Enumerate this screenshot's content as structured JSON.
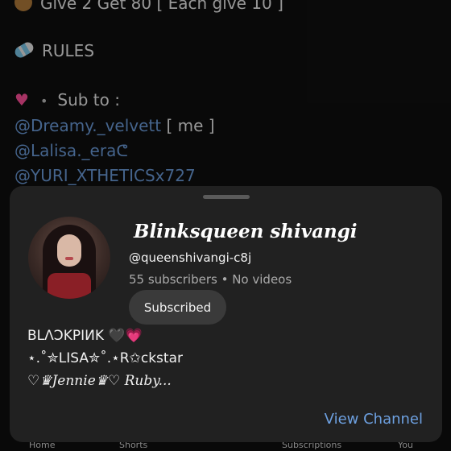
{
  "post": {
    "line1": "Give 2 Get 80 [ Each give 10 ]",
    "line2": "RULES",
    "sub_to_label": "Sub to :",
    "handle1": "@Dreamy._velvett",
    "handle1_suffix": "[ me ]",
    "handle2": "@Lalisa._eraᕦ",
    "handle3": "@YURI_XTHETICSx727",
    "icons": [
      "cookie-icon",
      "candy-icon",
      "heart-icon"
    ]
  },
  "bottom_nav": {
    "items": [
      "Home",
      "Shorts",
      "Subscriptions",
      "You"
    ]
  },
  "channel_sheet": {
    "name": "Blinksqueen shivangi",
    "handle": "@queenshivangi-c8j",
    "meta": "55 subscribers • No videos",
    "subscribe_label": "Subscribed",
    "description": [
      "BLΛϽKPIИK 🖤💗",
      "⋆.˚✮LISA✮˚.⋆R✩ckstar",
      "♡♛Jennie♛♡ Ruby..."
    ],
    "view_channel_label": "View Channel"
  },
  "colors": {
    "background": "#0f0f0f",
    "sheet": "#212121",
    "link": "#6da0e0",
    "subscribe_button": "#3a3a3a"
  }
}
